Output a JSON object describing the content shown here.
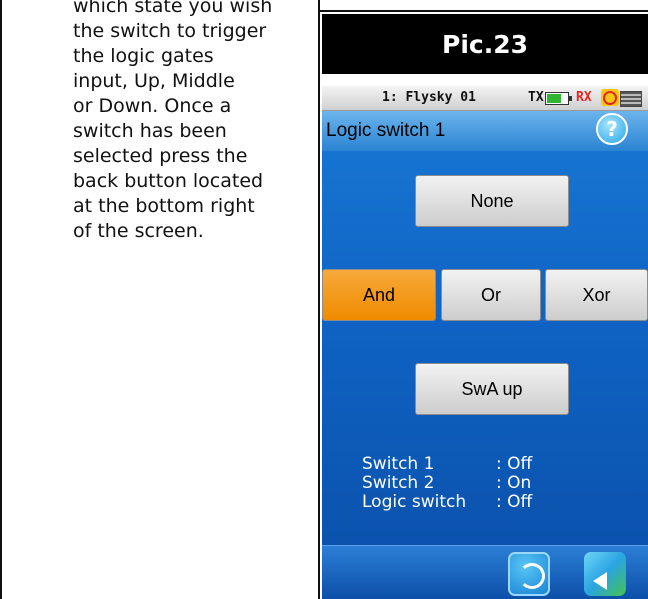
{
  "instructions": {
    "text": "which state you wish\nthe switch to trigger\nthe logic gates\ninput, Up, Middle\nor Down. Once a\nswitch has been\nselected press the\nback button located\nat the bottom right\nof the screen."
  },
  "caption": "Pic.23",
  "device": {
    "status_bar": {
      "model": "1: Flysky 01",
      "tx_label": "TX",
      "rx_label": "RX"
    },
    "title": "Logic switch 1",
    "help_glyph": "?",
    "buttons": {
      "none": "None",
      "and": "And",
      "or": "Or",
      "xor": "Xor",
      "switch": "SwA up"
    },
    "active_gate": "and",
    "info": [
      {
        "label": "Switch 1",
        "value": ": Off"
      },
      {
        "label": "Switch 2",
        "value": ": On"
      },
      {
        "label": "Logic switch",
        "value": ": Off"
      }
    ],
    "footer_icons": [
      "refresh-icon",
      "back-arrow-icon"
    ],
    "colors": {
      "screen_blue": "#0f63c4",
      "active_orange": "#f08b00",
      "rx_red": "#e8251f",
      "battery_green": "#2fb52f"
    }
  }
}
